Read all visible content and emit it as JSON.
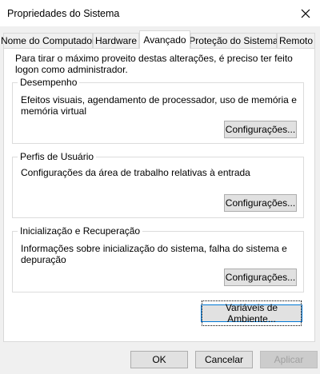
{
  "window": {
    "title": "Propriedades do Sistema"
  },
  "tabs": [
    {
      "label": "Nome do Computador"
    },
    {
      "label": "Hardware"
    },
    {
      "label": "Avançado"
    },
    {
      "label": "Proteção do Sistema"
    },
    {
      "label": "Remoto"
    }
  ],
  "active_tab": "Avançado",
  "intro_text": "Para tirar o máximo proveito destas alterações, é preciso ter feito logon como administrador.",
  "groups": {
    "performance": {
      "title": "Desempenho",
      "description": "Efeitos visuais, agendamento de processador, uso de memória e memória virtual",
      "button": "Configurações..."
    },
    "profiles": {
      "title": "Perfis de Usuário",
      "description": "Configurações da área de trabalho relativas à entrada",
      "button": "Configurações..."
    },
    "startup": {
      "title": "Inicialização e Recuperação",
      "description": "Informações sobre inicialização do sistema, falha do sistema e depuração",
      "button": "Configurações..."
    }
  },
  "env_button": "Variáveis de Ambiente...",
  "footer": {
    "ok": "OK",
    "cancel": "Cancelar",
    "apply": "Aplicar"
  },
  "icons": {
    "close": "close-icon"
  }
}
